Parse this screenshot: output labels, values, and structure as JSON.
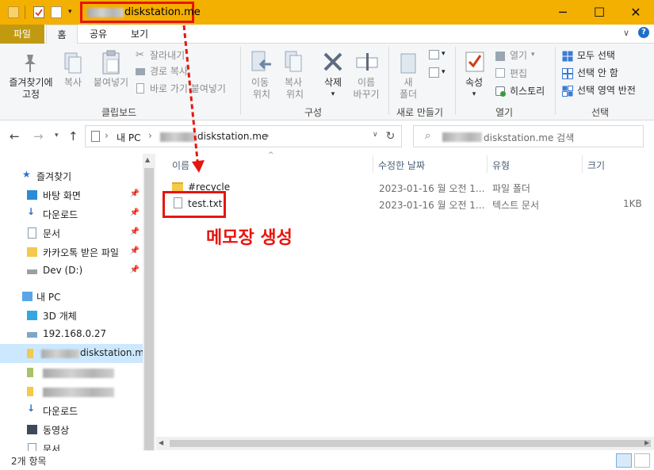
{
  "titlebar": {
    "title": "diskstation.me",
    "minimize": "─",
    "maximize": "☐",
    "close": "✕"
  },
  "ribbon_tabs": [
    "파일",
    "홈",
    "공유",
    "보기"
  ],
  "ribbon": {
    "pin_quick_access": [
      "즐겨찾기에",
      "고정"
    ],
    "copy": "복사",
    "paste": "붙여넣기",
    "cut": "잘라내기",
    "copy_path": "경로 복사",
    "paste_shortcut": "바로 가기 붙여넣기",
    "clipboard_group": "클립보드",
    "move_to": [
      "이동",
      "위치"
    ],
    "copy_to": [
      "복사",
      "위치"
    ],
    "delete": "삭제",
    "rename": [
      "이름",
      "바꾸기"
    ],
    "organize_group": "구성",
    "new_folder": [
      "새",
      "폴더"
    ],
    "new_group": "새로 만들기",
    "properties": "속성",
    "open": "열기",
    "edit": "편집",
    "history": "히스토리",
    "open_group": "열기",
    "select_all": "모두 선택",
    "select_none": "선택 안 함",
    "invert_selection": "선택 영역 반전",
    "select_group": "선택"
  },
  "address": {
    "crumbs": [
      "내 PC",
      "diskstation.me"
    ],
    "search_placeholder": "diskstation.me 검색"
  },
  "nav": {
    "quick_access": "즐겨찾기",
    "items_pinned": [
      "바탕 화면",
      "다운로드",
      "문서",
      "카카오톡 받은 파일",
      "Dev (D:)"
    ],
    "this_pc": "내 PC",
    "objects_3d": "3D 개체",
    "network_ip": "192.168.0.27",
    "selected": "diskstation.me",
    "downloads2": "다운로드",
    "videos": "동영상",
    "documents2": "문서"
  },
  "columns": {
    "name": "이름",
    "date": "수정한 날짜",
    "type": "유형",
    "size": "크기"
  },
  "files": [
    {
      "name": "#recycle",
      "date": "2023-01-16 월 오전 1...",
      "type": "파일 폴더",
      "size": ""
    },
    {
      "name": "test.txt",
      "date": "2023-01-16 월 오전 1...",
      "type": "텍스트 문서",
      "size": "1KB"
    }
  ],
  "annotation": "메모장 생성",
  "status": {
    "count": "2개 항목"
  },
  "colors": {
    "titlebar": "#f3b000",
    "annotation": "#e8140e",
    "selected": "#cce8ff"
  }
}
